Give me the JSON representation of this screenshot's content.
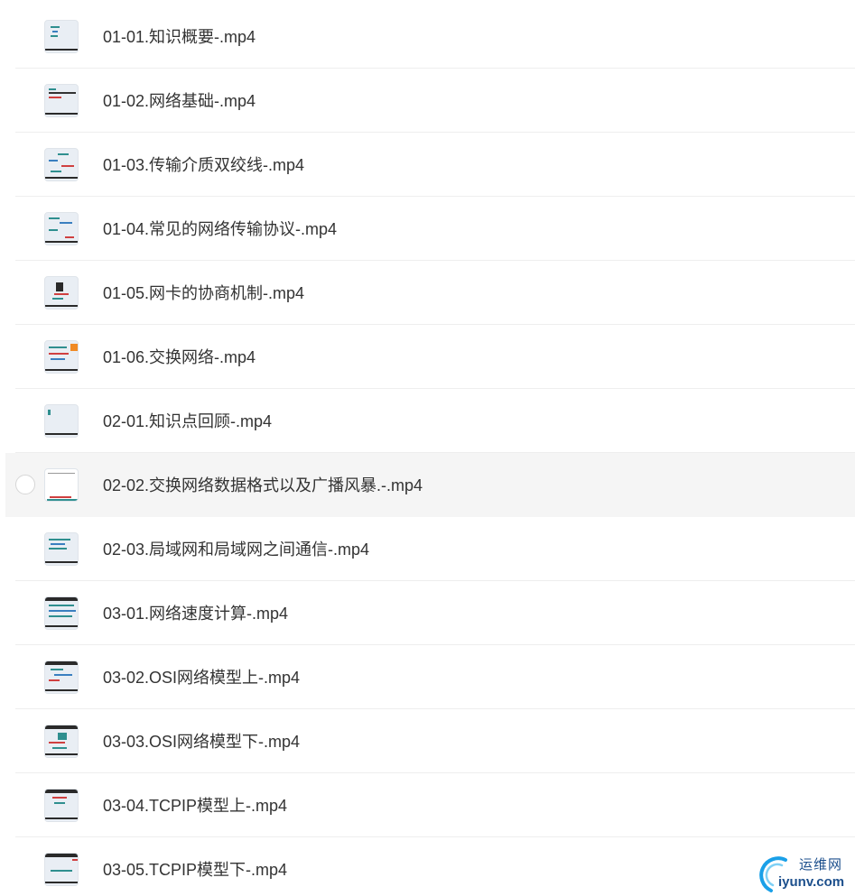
{
  "files": [
    {
      "name": "01-01.知识概要-.mp4",
      "thumb": "doc-thumbnail"
    },
    {
      "name": "01-02.网络基础-.mp4",
      "thumb": "doc-thumbnail"
    },
    {
      "name": "01-03.传输介质双绞线-.mp4",
      "thumb": "doc-thumbnail"
    },
    {
      "name": "01-04.常见的网络传输协议-.mp4",
      "thumb": "doc-thumbnail"
    },
    {
      "name": "01-05.网卡的协商机制-.mp4",
      "thumb": "doc-thumbnail"
    },
    {
      "name": "01-06.交换网络-.mp4",
      "thumb": "doc-thumbnail"
    },
    {
      "name": "02-01.知识点回顾-.mp4",
      "thumb": "doc-thumbnail"
    },
    {
      "name": "02-02.交换网络数据格式以及广播风暴.-.mp4",
      "thumb": "doc-thumbnail",
      "hovered": true
    },
    {
      "name": "02-03.局域网和局域网之间通信-.mp4",
      "thumb": "doc-thumbnail"
    },
    {
      "name": "03-01.网络速度计算-.mp4",
      "thumb": "doc-thumbnail"
    },
    {
      "name": "03-02.OSI网络模型上-.mp4",
      "thumb": "doc-thumbnail"
    },
    {
      "name": "03-03.OSI网络模型下-.mp4",
      "thumb": "doc-thumbnail"
    },
    {
      "name": "03-04.TCPIP模型上-.mp4",
      "thumb": "doc-thumbnail"
    },
    {
      "name": "03-05.TCPIP模型下-.mp4",
      "thumb": "doc-thumbnail"
    }
  ],
  "watermark": {
    "cn": "运维网",
    "en": "iyunv.com",
    "icon": "logo-icon"
  },
  "colors": {
    "text": "#333333",
    "hover_bg": "#f5f5f5",
    "divider": "#eeeeee",
    "brand": "#1c4f8c"
  }
}
